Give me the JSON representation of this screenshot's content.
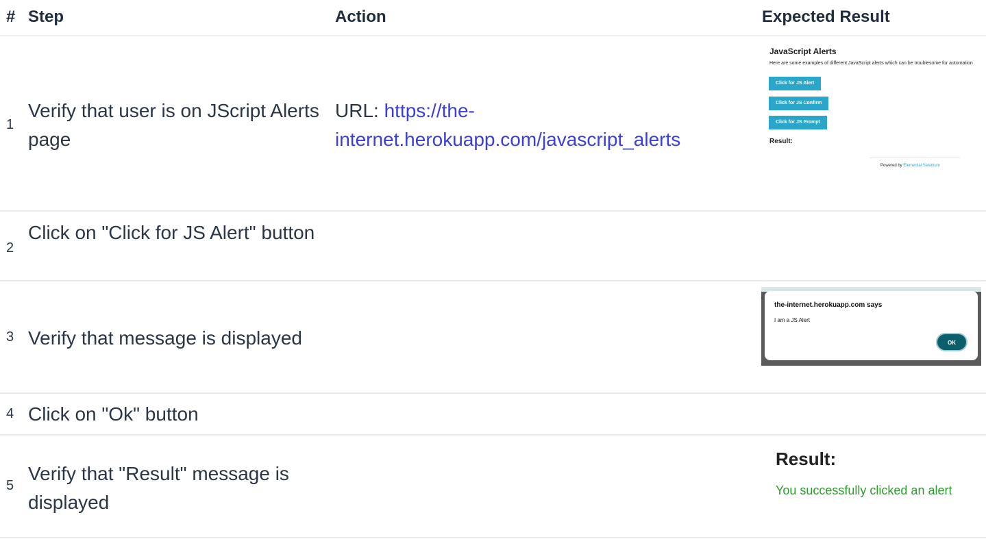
{
  "headers": {
    "num": "#",
    "step": "Step",
    "action": "Action",
    "expected": "Expected Result"
  },
  "rows": [
    {
      "num": "1",
      "step": "Verify that user is on JScript Alerts page",
      "action_prefix": "URL: ",
      "action_link": "https://the-internet.herokuapp.com/javascript_alerts"
    },
    {
      "num": "2",
      "step": "Click on \"Click for JS Alert\" button"
    },
    {
      "num": "3",
      "step": "Verify that message is displayed"
    },
    {
      "num": "4",
      "step": "Click on \"Ok\" button"
    },
    {
      "num": "5",
      "step": "Verify that \"Result\" message is displayed"
    }
  ],
  "shot1": {
    "title": "JavaScript Alerts",
    "desc": "Here are some examples of different JavaScript alerts which can be troublesome for automation",
    "buttons": [
      "Click for JS Alert",
      "Click for JS Confirm",
      "Click for JS Prompt"
    ],
    "result_label": "Result:",
    "powered_prefix": "Powered by ",
    "powered_link": "Elemental Selenium",
    "button_color": "#2ba6cb"
  },
  "shot2": {
    "edge_char": "c",
    "title": "the-internet.herokuapp.com says",
    "message": "I am a JS Alert",
    "ok": "OK"
  },
  "shot3": {
    "title": "Result:",
    "message": "You successfully clicked an alert",
    "message_color": "#2c9a2c"
  }
}
